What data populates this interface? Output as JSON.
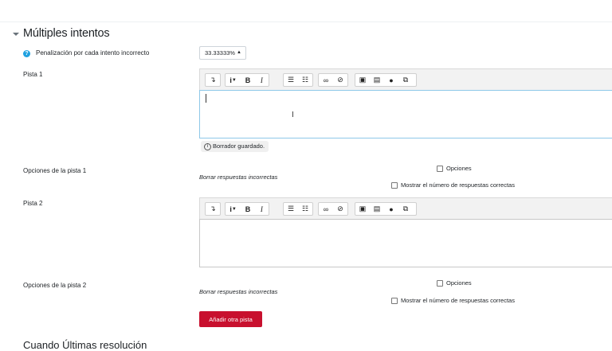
{
  "section": {
    "title": "Múltiples intentos"
  },
  "penalty": {
    "label": "Penalización por cada intento incorrecto",
    "value": "33.33333%"
  },
  "hint1": {
    "label": "Pista 1",
    "draft_status": "Borrador guardado.",
    "options_label": "Opciones de la pista 1",
    "clear_incorrect": "Borrar respuestas incorrectas",
    "options_checkbox": "Opciones",
    "show_count_checkbox": "Mostrar el número de respuestas correctas"
  },
  "hint2": {
    "label": "Pista 2",
    "options_label": "Opciones de la pista 2",
    "clear_incorrect": "Borrar respuestas incorrectas",
    "options_checkbox": "Opciones",
    "show_count_checkbox": "Mostrar el número de respuestas correctas"
  },
  "add_hint_button": "Añadir otra pista",
  "next_section_title": "Cuando Últimas resolución",
  "toolbar_icons": [
    "collapse-icon",
    "info-style-icon",
    "bold-icon",
    "italic-icon",
    "bullet-list-icon",
    "numbered-list-icon",
    "link-icon",
    "unlink-icon",
    "image-icon",
    "media-icon",
    "microphone-icon",
    "manage-files-icon"
  ],
  "colors": {
    "accent": "#c8102e",
    "focus_border": "#8ec8e8",
    "help_icon": "#1fa1e0"
  }
}
